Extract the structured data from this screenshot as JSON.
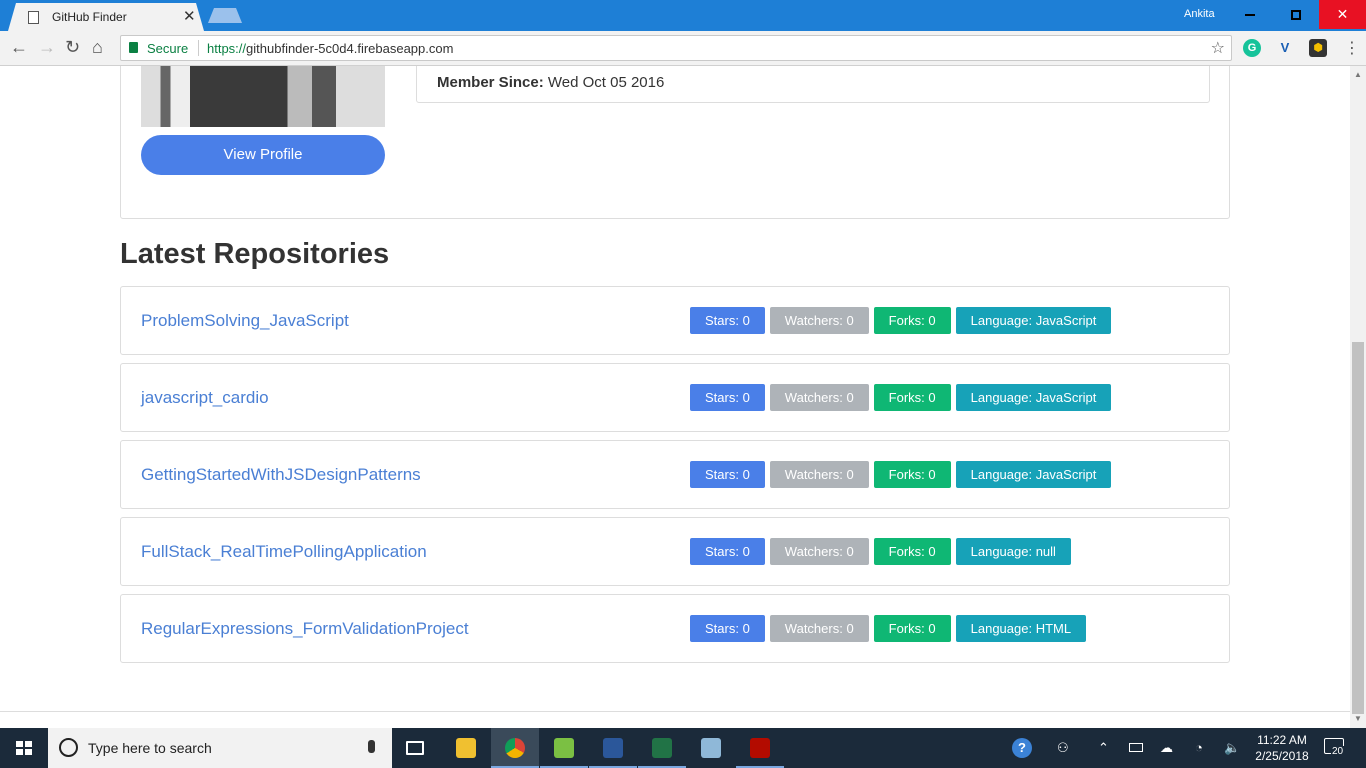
{
  "browser": {
    "tab_title": "GitHub Finder",
    "tab_close": "✕",
    "user": "Ankita",
    "secure_label": "Secure",
    "url_scheme": "https://",
    "url_rest": "githubfinder-5c0d4.firebaseapp.com"
  },
  "profile": {
    "view_profile_label": "View Profile",
    "member_since_label": "Member Since:",
    "member_since_value": "Wed Oct 05 2016"
  },
  "repos_title": "Latest Repositories",
  "repos": [
    {
      "name": "ProblemSolving_JavaScript",
      "stars": "Stars: 0",
      "watchers": "Watchers: 0",
      "forks": "Forks: 0",
      "language": "Language: JavaScript"
    },
    {
      "name": "javascript_cardio",
      "stars": "Stars: 0",
      "watchers": "Watchers: 0",
      "forks": "Forks: 0",
      "language": "Language: JavaScript"
    },
    {
      "name": "GettingStartedWithJSDesignPatterns",
      "stars": "Stars: 0",
      "watchers": "Watchers: 0",
      "forks": "Forks: 0",
      "language": "Language: JavaScript"
    },
    {
      "name": "FullStack_RealTimePollingApplication",
      "stars": "Stars: 0",
      "watchers": "Watchers: 0",
      "forks": "Forks: 0",
      "language": "Language: null"
    },
    {
      "name": "RegularExpressions_FormValidationProject",
      "stars": "Stars: 0",
      "watchers": "Watchers: 0",
      "forks": "Forks: 0",
      "language": "Language: HTML"
    }
  ],
  "taskbar": {
    "search_placeholder": "Type here to search",
    "time": "11:22 AM",
    "date": "2/25/2018",
    "notification_count": "20"
  },
  "colors": {
    "titlebar": "#1e7fd6",
    "accent_blue": "#4a7fe8",
    "badge_watchers": "#aeb3b8",
    "badge_forks": "#0fb774",
    "badge_language": "#17a2b8"
  },
  "icons": [
    "page-icon",
    "back-arrow-icon",
    "forward-arrow-icon",
    "reload-icon",
    "home-icon",
    "lock-icon",
    "star-icon",
    "grammarly-icon",
    "vpn-icon",
    "extension-icon",
    "menu-icon",
    "windows-icon",
    "cortana-icon",
    "mic-icon",
    "task-view-icon",
    "file-explorer-icon",
    "chrome-icon",
    "notepad-icon",
    "word-icon",
    "excel-icon",
    "tablet-icon",
    "acrobat-icon",
    "help-icon",
    "people-icon",
    "chevron-up-icon",
    "battery-icon",
    "network-icon",
    "wifi-icon",
    "volume-icon",
    "notification-icon"
  ]
}
